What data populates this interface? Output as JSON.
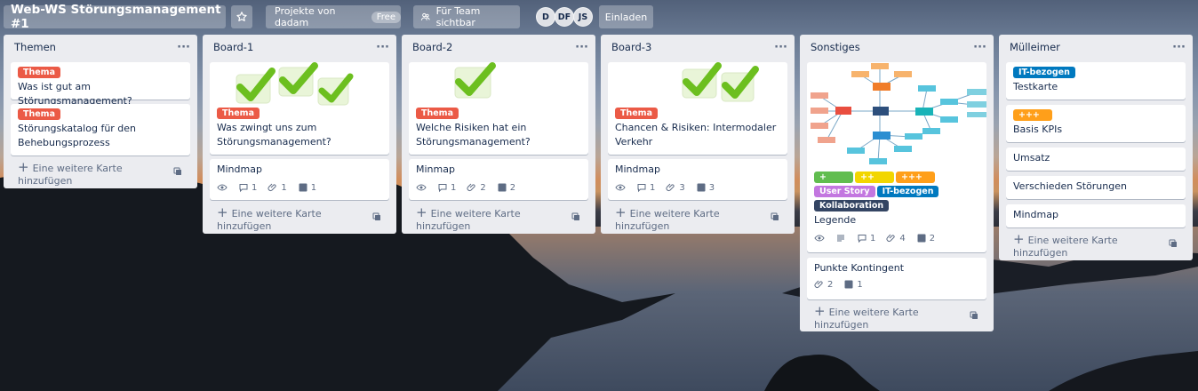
{
  "header": {
    "board_title": "Web-WS Störungsmanagement #1",
    "workspace": "Projekte von dadam",
    "plan": "Free",
    "visibility": "Für Team sichtbar",
    "members": [
      "D",
      "DF",
      "JS"
    ],
    "invite": "Einladen"
  },
  "lists": [
    {
      "title": "Themen",
      "add": "Eine weitere Karte hinzufügen",
      "cards": [
        {
          "labels": [
            {
              "text": "Thema",
              "color": "#eb5a46"
            }
          ],
          "title": "Was ist gut am Störungsmanagement?"
        },
        {
          "labels": [
            {
              "text": "Thema",
              "color": "#eb5a46"
            }
          ],
          "title": "Störungskatalog für den Behebungsprozess"
        }
      ]
    },
    {
      "title": "Board-1",
      "add": "Eine weitere Karte hinzufügen",
      "cards": [
        {
          "cover": "checkmarks",
          "labels": [
            {
              "text": "Thema",
              "color": "#eb5a46"
            }
          ],
          "title": "Was zwingt uns zum Störungsmanagement?"
        },
        {
          "title": "Mindmap",
          "badges": {
            "comments": "1",
            "attachments": "1",
            "checklist": "1"
          }
        }
      ]
    },
    {
      "title": "Board-2",
      "add": "Eine weitere Karte hinzufügen",
      "cards": [
        {
          "cover": "checkmarks",
          "labels": [
            {
              "text": "Thema",
              "color": "#eb5a46"
            }
          ],
          "title": "Welche Risiken hat ein Störungsmanagement?"
        },
        {
          "title": "Minmap",
          "badges": {
            "comments": "1",
            "attachments": "2",
            "checklist": "2"
          }
        }
      ]
    },
    {
      "title": "Board-3",
      "add": "Eine weitere Karte hinzufügen",
      "cards": [
        {
          "cover": "checkmarks",
          "labels": [
            {
              "text": "Thema",
              "color": "#eb5a46"
            }
          ],
          "title": "Chancen & Risiken: Intermodaler Verkehr"
        },
        {
          "title": "Mindmap",
          "badges": {
            "comments": "1",
            "attachments": "3",
            "checklist": "3"
          }
        }
      ]
    },
    {
      "title": "Sonstiges",
      "add": "Eine weitere Karte hinzufügen",
      "cards": [
        {
          "cover": "mindmap",
          "labels": [
            {
              "text": "+",
              "color": "#61bd4f"
            },
            {
              "text": "++",
              "color": "#f2d600"
            },
            {
              "text": "+++",
              "color": "#ff9f1a"
            },
            {
              "text": "User Story",
              "color": "#c377e0"
            },
            {
              "text": "IT-bezogen",
              "color": "#0079bf"
            },
            {
              "text": "Kollaboration",
              "color": "#344563"
            }
          ],
          "title": "Legende",
          "badges": {
            "comments": "1",
            "attachments": "4",
            "checklist": "2"
          }
        },
        {
          "title": "Punkte Kontingent",
          "badges": {
            "attachments": "2",
            "checklist": "1"
          }
        }
      ]
    },
    {
      "title": "Mülleimer",
      "add": "Eine weitere Karte hinzufügen",
      "cards": [
        {
          "labels": [
            {
              "text": "IT-bezogen",
              "color": "#0079bf"
            }
          ],
          "title": "Testkarte"
        },
        {
          "labels": [
            {
              "text": "+++",
              "color": "#ff9f1a"
            }
          ],
          "title": "Basis KPIs"
        },
        {
          "title": "Umsatz"
        },
        {
          "title": "Verschieden Störungen"
        },
        {
          "title": "Mindmap"
        }
      ]
    }
  ]
}
